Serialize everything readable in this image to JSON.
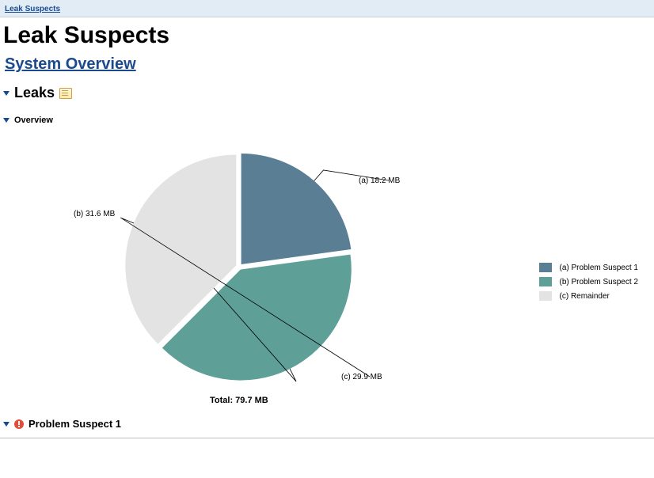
{
  "breadcrumb": "Leak Suspects",
  "title": "Leak Suspects",
  "sys_overview": "System Overview",
  "section_leaks": "Leaks",
  "section_overview": "Overview",
  "section_problem1": "Problem Suspect 1",
  "total_label": "Total: 79.7 MB",
  "slice_labels": {
    "a": "(a)  18.2 MB",
    "b": "(b)  31.6 MB",
    "c": "(c)  29.9 MB"
  },
  "legend": {
    "a": "(a)  Problem Suspect 1",
    "b": "(b)  Problem Suspect 2",
    "c": "(c)  Remainder"
  },
  "colors": {
    "a": "#5a7e93",
    "b": "#5ea097",
    "c": "#e3e3e3"
  },
  "chart_data": {
    "type": "pie",
    "title": "Leak Suspects Overview",
    "total_mb": 79.7,
    "series": [
      {
        "key": "a",
        "name": "Problem Suspect 1",
        "value_mb": 18.2,
        "color": "#5a7e93"
      },
      {
        "key": "b",
        "name": "Problem Suspect 2",
        "value_mb": 31.6,
        "color": "#5ea097"
      },
      {
        "key": "c",
        "name": "Remainder",
        "value_mb": 29.9,
        "color": "#e3e3e3"
      }
    ]
  }
}
